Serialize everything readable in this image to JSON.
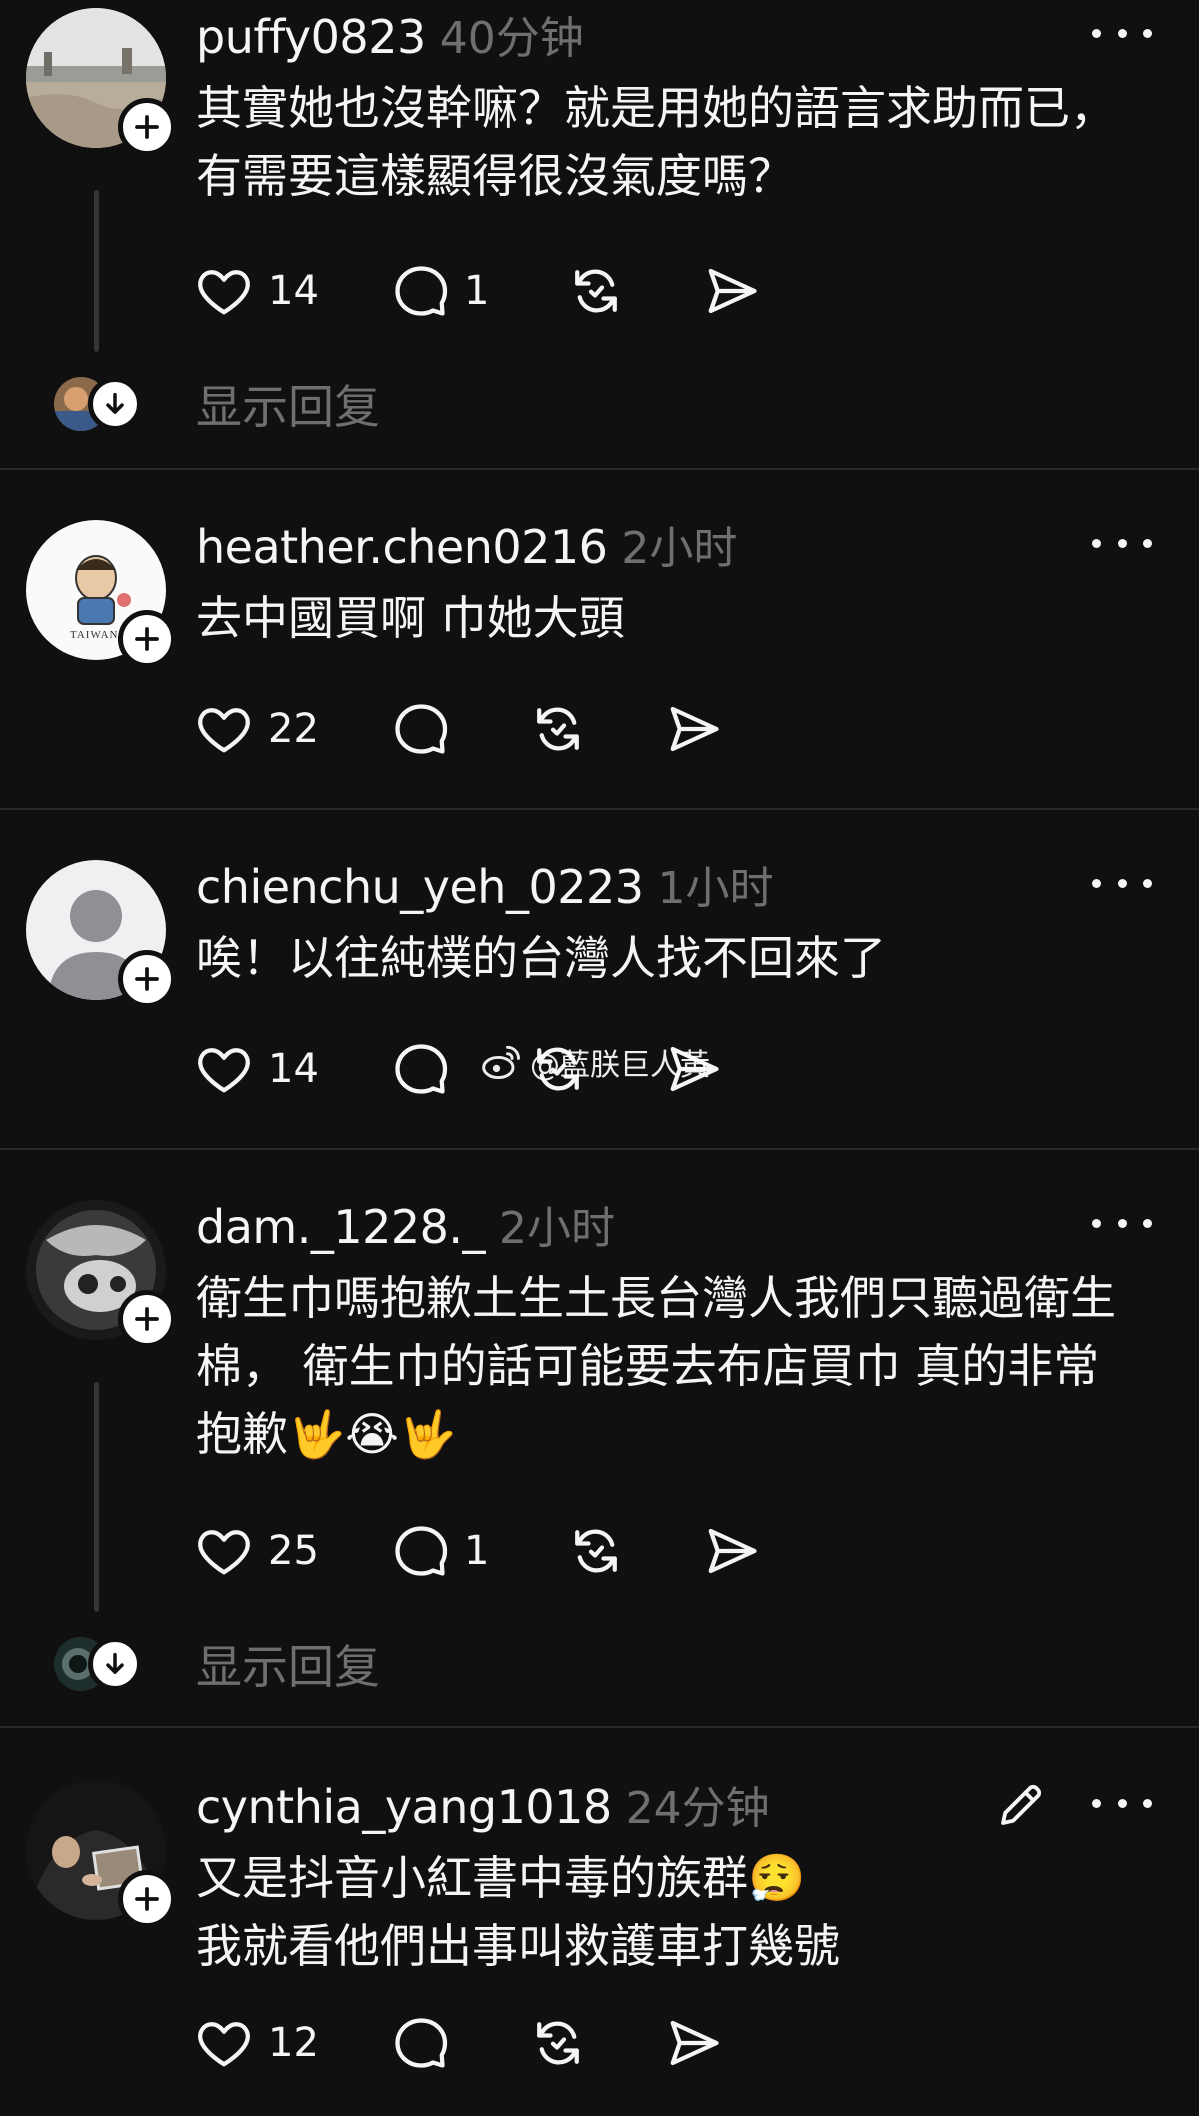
{
  "posts": [
    {
      "username": "puffy0823",
      "time": "40分钟",
      "text_lines": [
        "其實她也沒幹嘛？就是用她的語言求助而已，",
        "有需要這樣顯得很沒氣度嗎？"
      ],
      "likes": "14",
      "replies": "1",
      "show_replies": "显示回复"
    },
    {
      "username": "heather.chen0216",
      "time": "2小时",
      "avatar_caption": "TAIWAN",
      "text_lines": [
        "去中國買啊 巾她大頭"
      ],
      "likes": "22",
      "replies": ""
    },
    {
      "username": "chienchu_yeh_0223",
      "time": "1小时",
      "text_lines": [
        "唉！以往純樸的台灣人找不回來了"
      ],
      "likes": "14",
      "replies": ""
    },
    {
      "username": "dam._1228._",
      "time": "2小时",
      "text_lines": [
        "衛生巾嗎抱歉土生土長台灣人我們只聽過衛生",
        "棉， 衛生巾的話可能要去布店買巾 真的非常",
        "抱歉🤟😭🤟"
      ],
      "likes": "25",
      "replies": "1",
      "show_replies": "显示回复"
    },
    {
      "username": "cynthia_yang1018",
      "time": "24分钟",
      "text_lines": [
        "又是抖音小紅書中毒的族群😮‍💨",
        "我就看他們出事叫救護車打幾號"
      ],
      "likes": "12",
      "replies": ""
    }
  ],
  "watermark": "@藍朕巨人黃",
  "icons": {
    "like": "heart-icon",
    "reply": "comment-bubble-icon",
    "repost": "repost-icon",
    "share": "send-icon",
    "more": "more-dots-icon",
    "follow": "plus-icon",
    "expand": "arrow-down-icon",
    "edit": "pencil-icon",
    "watermark_logo": "weibo-icon"
  }
}
